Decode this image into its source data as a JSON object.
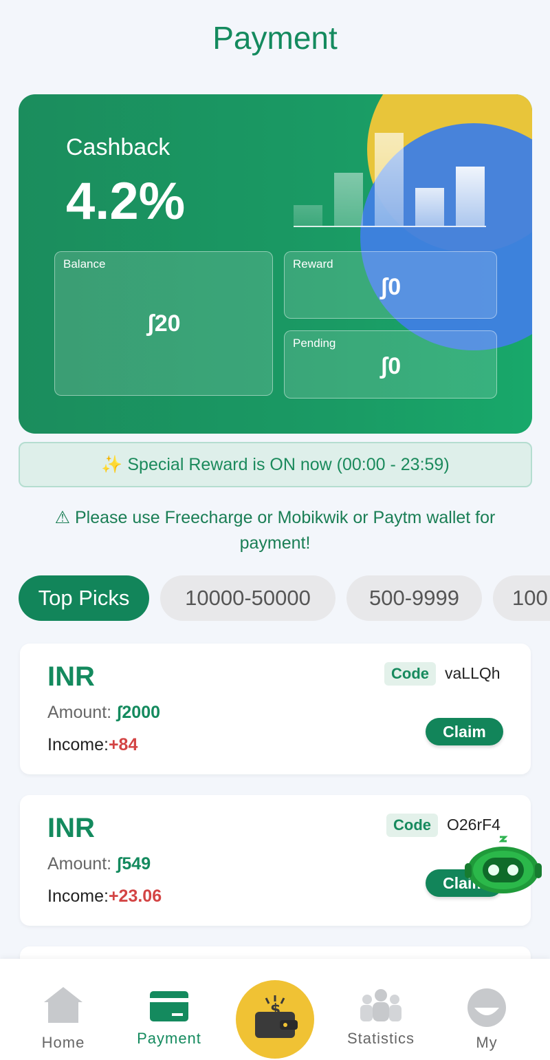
{
  "header": {
    "title": "Payment"
  },
  "hero": {
    "cashback_label": "Cashback",
    "cashback_value": "4.2%",
    "balance_label": "Balance",
    "balance_value": "ʃ20",
    "reward_label": "Reward",
    "reward_value": "ʃ0",
    "pending_label": "Pending",
    "pending_value": "ʃ0",
    "bar_levels": [
      0.22,
      0.57,
      1.0,
      0.41,
      0.64
    ]
  },
  "special": {
    "text": "✨ Special Reward is ON now (00:00 - 23:59)"
  },
  "warning": {
    "text": "⚠ Please use Freecharge or Mobikwik or Paytm wallet for payment!"
  },
  "filters": {
    "chips": [
      "Top Picks",
      "10000-50000",
      "500-9999",
      "100"
    ],
    "active": "Top Picks"
  },
  "orders": [
    {
      "currency": "INR",
      "code_label": "Code",
      "code": "vaLLQh",
      "amount_label": "Amount: ",
      "amount": "ʃ2000",
      "income_label": "Income:",
      "income": "+84",
      "claim": "Claim"
    },
    {
      "currency": "INR",
      "code_label": "Code",
      "code": "O26rF4",
      "amount_label": "Amount: ",
      "amount": "ʃ549",
      "income_label": "Income:",
      "income": "+23.06",
      "claim": "Claim"
    }
  ],
  "nav": {
    "home": "Home",
    "payment": "Payment",
    "statistics": "Statistics",
    "my": "My"
  },
  "colors": {
    "brand_green": "#148a5e",
    "income_red": "#d34444",
    "accent_yellow": "#f0c234",
    "accent_blue": "#3f80e3"
  }
}
